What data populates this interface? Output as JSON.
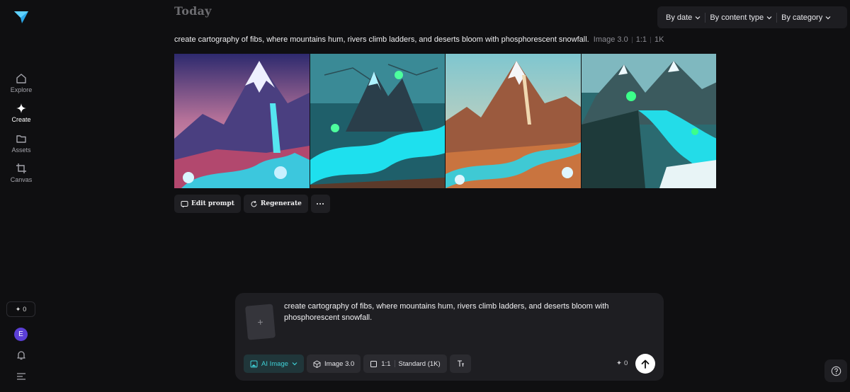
{
  "sidebar": {
    "logo_icon": "paper-plane-logo-icon",
    "items": [
      {
        "label": "Explore",
        "icon": "home-icon"
      },
      {
        "label": "Create",
        "icon": "sparkle-icon"
      },
      {
        "label": "Assets",
        "icon": "folder-icon"
      },
      {
        "label": "Canvas",
        "icon": "crop-icon"
      }
    ],
    "credits": "0",
    "avatar_initial": "E"
  },
  "header": {
    "section_title": "Today",
    "filters": [
      {
        "label": "By date"
      },
      {
        "label": "By content type"
      },
      {
        "label": "By category"
      }
    ]
  },
  "generation": {
    "prompt": "create cartography of fibs, where mountains hum, rivers climb ladders, and deserts bloom with phosphorescent snowfall.",
    "model": "Image 3.0",
    "ratio": "1:1",
    "resolution": "1K",
    "images": [
      {
        "icon": "generated-image"
      },
      {
        "icon": "generated-image"
      },
      {
        "icon": "generated-image"
      },
      {
        "icon": "generated-image"
      }
    ],
    "actions": {
      "edit_prompt": "Edit prompt",
      "regenerate": "Regenerate",
      "more": "···"
    }
  },
  "composer": {
    "upload_symbol": "+",
    "prompt_text": "create cartography of fibs, where mountains hum, rivers climb ladders, and deserts bloom with phosphorescent snowfall.",
    "mode": "AI Image",
    "model": "Image 3.0",
    "ratio": "1:1",
    "quality": "Standard (1K)",
    "credit_cost": "0"
  },
  "colors": {
    "background": "#0f0f11",
    "panel": "#1e1e22",
    "accent": "#3fd0d6",
    "avatar": "#5b3fd6"
  }
}
